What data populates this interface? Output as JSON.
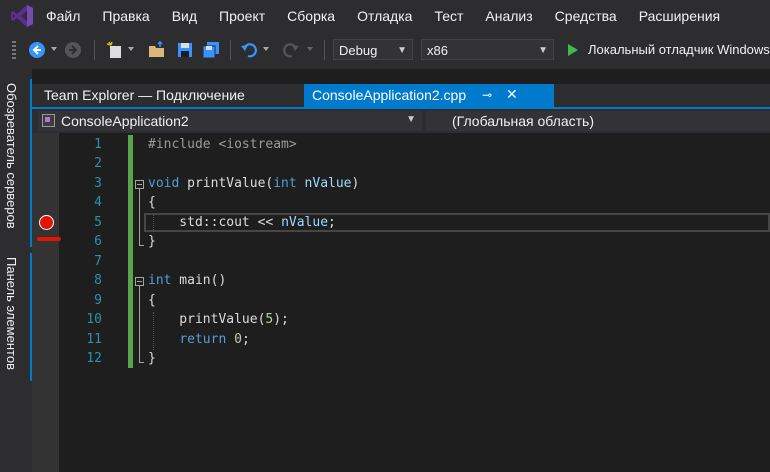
{
  "menu": [
    "Файл",
    "Правка",
    "Вид",
    "Проект",
    "Сборка",
    "Отладка",
    "Тест",
    "Анализ",
    "Средства",
    "Расширения"
  ],
  "toolbar": {
    "configuration": "Debug",
    "platform": "x86",
    "run_label": "Локальный отладчик Windows"
  },
  "side_tabs": [
    "Обозреватель серверов",
    "Панель элементов"
  ],
  "tabs": {
    "inactive": "Team Explorer — Подключение",
    "active": "ConsoleApplication2.cpp",
    "pin": "⊸",
    "close": "✕"
  },
  "navbar": {
    "project": "ConsoleApplication2",
    "scope": "(Глобальная область)"
  },
  "editor": {
    "line_numbers": [
      "1",
      "2",
      "3",
      "4",
      "5",
      "6",
      "7",
      "8",
      "9",
      "10",
      "11",
      "12"
    ],
    "lines": [
      "#include <iostream>",
      "",
      "void printValue(int nValue)",
      "{",
      "    std::cout << nValue;",
      "}",
      "",
      "int main()",
      "{",
      "    printValue(5);",
      "    return 0;",
      "}"
    ],
    "breakpoint_line": 5,
    "colors": {
      "keyword": "#569cd6",
      "preprocessor": "#9b9b9b",
      "parameter": "#9cdcfe",
      "number": "#b5cea8",
      "line_number": "#2b91af",
      "breakpoint": "#e51400",
      "accent": "#007acc"
    }
  }
}
